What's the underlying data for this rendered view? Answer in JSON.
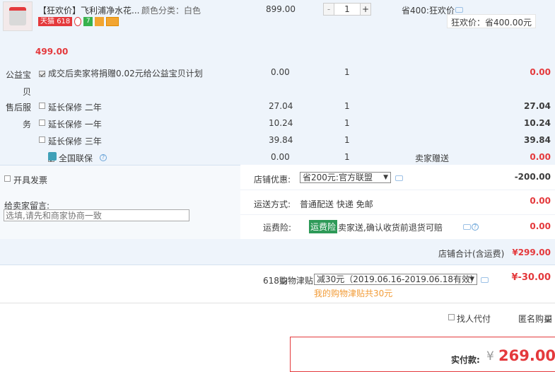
{
  "item": {
    "title": "【狂欢价】飞利浦净水花...",
    "sku": "颜色分类：白色",
    "price": "899.00",
    "qty": "1",
    "discount_tag": "省400:狂欢价",
    "discount_detail": "狂欢价：省400.00元",
    "subtotal": "499.00",
    "badges": {
      "tmall": "天猫",
      "festival": "618"
    }
  },
  "charity": {
    "label": "公益宝贝",
    "text": "成交后卖家将捐赠0.02元给公益宝贝计划",
    "price": "0.00",
    "qty": "1",
    "total": "0.00"
  },
  "services": {
    "label": "售后服务",
    "rows": [
      {
        "name": "延长保修 二年",
        "price": "27.04",
        "qty": "1",
        "total": "27.04",
        "checked": false
      },
      {
        "name": "延长保修 一年",
        "price": "10.24",
        "qty": "1",
        "total": "10.24",
        "checked": false
      },
      {
        "name": "延长保修 三年",
        "price": "39.84",
        "qty": "1",
        "total": "39.84",
        "checked": false
      },
      {
        "name": "全国联保",
        "price": "0.00",
        "qty": "1",
        "total": "0.00",
        "checked": true,
        "note": "卖家赠送"
      }
    ]
  },
  "invoice": {
    "label": "开具发票"
  },
  "shop_discount": {
    "label": "店铺优惠:",
    "value": "省200元:官方联盟",
    "amount": "-200.00"
  },
  "message": {
    "label": "给卖家留言:",
    "placeholder": "选填,请先和商家协商一致"
  },
  "shipping": {
    "label": "运送方式:",
    "value": "普通配送 快递 免邮",
    "amount": "0.00"
  },
  "insurance": {
    "label": "运费险:",
    "tag": "运费险",
    "text": "卖家送,确认收货前退货可赔",
    "amount": "0.00"
  },
  "shop_total": {
    "label": "店铺合计(含运费)",
    "amount": "¥299.00"
  },
  "allowance": {
    "label": "618购物津贴",
    "value": "减30元（2019.06.16-2019.06.18有效）",
    "amount": "¥-30.00",
    "note": "我的购物津贴共30元"
  },
  "options": {
    "proxy": "找人代付",
    "anonymous": "匿名购买"
  },
  "payment": {
    "label": "实付款:",
    "currency": "¥",
    "amount": "269.00"
  },
  "colors": {
    "accent": "#e4393c",
    "row_bg": "#eef4fb",
    "orange": "#f29c38"
  }
}
